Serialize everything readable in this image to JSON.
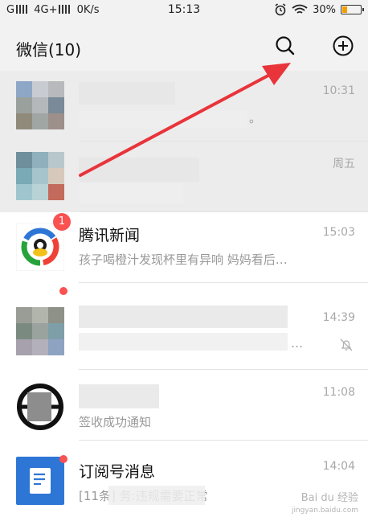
{
  "status_bar": {
    "carrier_left": "G",
    "network": "4G+",
    "speed": "0K/s",
    "time": "15:13",
    "battery_percent": "30%",
    "battery_level": 0.3
  },
  "header": {
    "title": "微信(10)",
    "icons": [
      "search-icon",
      "add-icon"
    ]
  },
  "chats": [
    {
      "name": "",
      "message": "。",
      "time": "10:31",
      "pinned": true
    },
    {
      "name": "",
      "message": "",
      "time": "周五",
      "pinned": true
    },
    {
      "name": "腾讯新闻",
      "message": "孩子喝橙汁发现杯里有异响 妈妈看后…",
      "time": "15:03",
      "badge": "1"
    },
    {
      "name": "",
      "message": "…",
      "time": "14:39",
      "unread_dot": true,
      "muted": true
    },
    {
      "name": "",
      "message": "签收成功通知",
      "time": "11:08"
    },
    {
      "name": "订阅号消息",
      "message": "[11条]                    务:违规需要正常",
      "time": "14:04",
      "unread_dot": true
    }
  ],
  "colors": {
    "badge": "#fa5151",
    "arrow": "#e8343a",
    "tencent_blue": "#2e76d6"
  },
  "watermark": {
    "line1": "Bai du 经验",
    "line2": "jingyan.baidu.com"
  }
}
